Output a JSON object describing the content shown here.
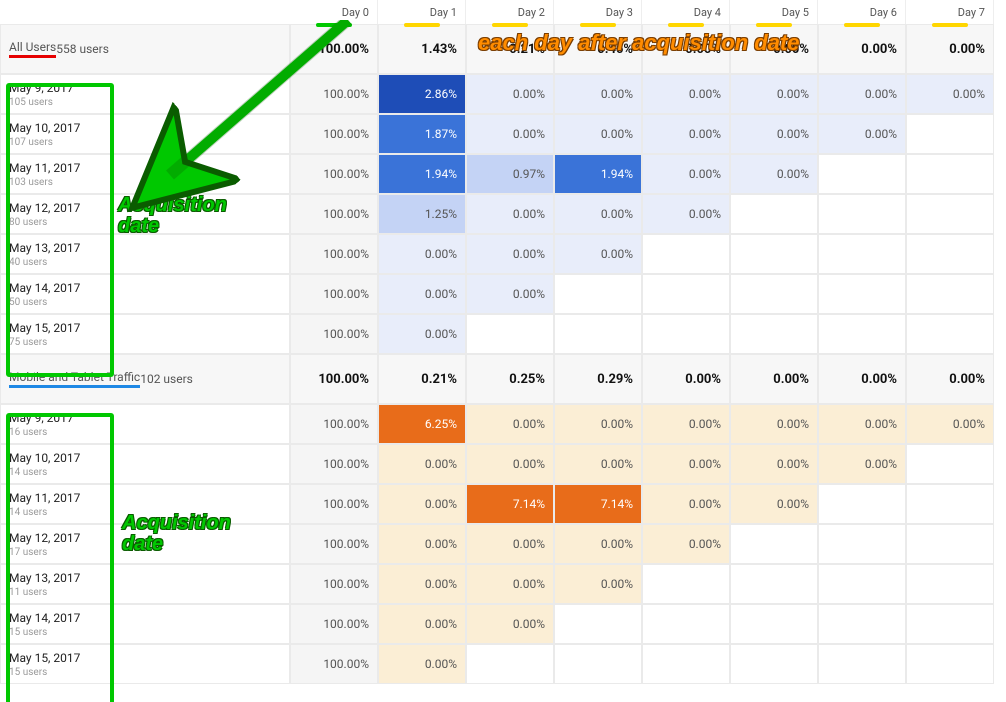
{
  "annotations": {
    "top": "each day after acquisition date",
    "acq1": "Acquisition\ndate",
    "acq2": "Acquisition\ndate"
  },
  "headers": [
    "Day 0",
    "Day 1",
    "Day 2",
    "Day 3",
    "Day 4",
    "Day 5",
    "Day 6",
    "Day 7"
  ],
  "header_underline_colors": [
    "#00c800",
    "#ffd600",
    "#ffd600",
    "#ffd600",
    "#ffd600",
    "#ffd600",
    "#ffd600",
    "#ffd600"
  ],
  "segments": [
    {
      "title": "All Users",
      "subtitle": "558 users",
      "underline": "red",
      "summary": [
        "100.00%",
        "1.43%",
        "0.21%",
        "0.46%",
        "0.00%",
        "0.00%",
        "0.00%",
        "0.00%"
      ],
      "palette": "blue",
      "rows": [
        {
          "date": "May 9, 2017",
          "users": "105 users",
          "cells": [
            {
              "v": "100.00%",
              "c": "day0"
            },
            {
              "v": "2.86%",
              "c": "b3"
            },
            {
              "v": "0.00%",
              "c": "b0"
            },
            {
              "v": "0.00%",
              "c": "b0"
            },
            {
              "v": "0.00%",
              "c": "b0"
            },
            {
              "v": "0.00%",
              "c": "b0"
            },
            {
              "v": "0.00%",
              "c": "b0"
            },
            {
              "v": "0.00%",
              "c": "b0"
            }
          ]
        },
        {
          "date": "May 10, 2017",
          "users": "107 users",
          "cells": [
            {
              "v": "100.00%",
              "c": "day0"
            },
            {
              "v": "1.87%",
              "c": "b2"
            },
            {
              "v": "0.00%",
              "c": "b0"
            },
            {
              "v": "0.00%",
              "c": "b0"
            },
            {
              "v": "0.00%",
              "c": "b0"
            },
            {
              "v": "0.00%",
              "c": "b0"
            },
            {
              "v": "0.00%",
              "c": "b0"
            },
            {
              "v": "",
              "c": "empty"
            }
          ]
        },
        {
          "date": "May 11, 2017",
          "users": "103 users",
          "cells": [
            {
              "v": "100.00%",
              "c": "day0"
            },
            {
              "v": "1.94%",
              "c": "b2"
            },
            {
              "v": "0.97%",
              "c": "b1"
            },
            {
              "v": "1.94%",
              "c": "b2"
            },
            {
              "v": "0.00%",
              "c": "b0"
            },
            {
              "v": "0.00%",
              "c": "b0"
            },
            {
              "v": "",
              "c": "empty"
            },
            {
              "v": "",
              "c": "empty"
            }
          ]
        },
        {
          "date": "May 12, 2017",
          "users": "80 users",
          "cells": [
            {
              "v": "100.00%",
              "c": "day0"
            },
            {
              "v": "1.25%",
              "c": "b1"
            },
            {
              "v": "0.00%",
              "c": "b0"
            },
            {
              "v": "0.00%",
              "c": "b0"
            },
            {
              "v": "0.00%",
              "c": "b0"
            },
            {
              "v": "",
              "c": "empty"
            },
            {
              "v": "",
              "c": "empty"
            },
            {
              "v": "",
              "c": "empty"
            }
          ]
        },
        {
          "date": "May 13, 2017",
          "users": "40 users",
          "cells": [
            {
              "v": "100.00%",
              "c": "day0"
            },
            {
              "v": "0.00%",
              "c": "b0"
            },
            {
              "v": "0.00%",
              "c": "b0"
            },
            {
              "v": "0.00%",
              "c": "b0"
            },
            {
              "v": "",
              "c": "empty"
            },
            {
              "v": "",
              "c": "empty"
            },
            {
              "v": "",
              "c": "empty"
            },
            {
              "v": "",
              "c": "empty"
            }
          ]
        },
        {
          "date": "May 14, 2017",
          "users": "50 users",
          "cells": [
            {
              "v": "100.00%",
              "c": "day0"
            },
            {
              "v": "0.00%",
              "c": "b0"
            },
            {
              "v": "0.00%",
              "c": "b0"
            },
            {
              "v": "",
              "c": "empty"
            },
            {
              "v": "",
              "c": "empty"
            },
            {
              "v": "",
              "c": "empty"
            },
            {
              "v": "",
              "c": "empty"
            },
            {
              "v": "",
              "c": "empty"
            }
          ]
        },
        {
          "date": "May 15, 2017",
          "users": "75 users",
          "cells": [
            {
              "v": "100.00%",
              "c": "day0"
            },
            {
              "v": "0.00%",
              "c": "b0"
            },
            {
              "v": "",
              "c": "empty"
            },
            {
              "v": "",
              "c": "empty"
            },
            {
              "v": "",
              "c": "empty"
            },
            {
              "v": "",
              "c": "empty"
            },
            {
              "v": "",
              "c": "empty"
            },
            {
              "v": "",
              "c": "empty"
            }
          ]
        }
      ]
    },
    {
      "title": "Mobile and Tablet Traffic",
      "subtitle": "102 users",
      "underline": "blue",
      "summary": [
        "100.00%",
        "0.21%",
        "0.25%",
        "0.29%",
        "0.00%",
        "0.00%",
        "0.00%",
        "0.00%"
      ],
      "palette": "orange",
      "rows": [
        {
          "date": "May 9, 2017",
          "users": "16 users",
          "cells": [
            {
              "v": "100.00%",
              "c": "day0"
            },
            {
              "v": "6.25%",
              "c": "o2"
            },
            {
              "v": "0.00%",
              "c": "o0"
            },
            {
              "v": "0.00%",
              "c": "o0"
            },
            {
              "v": "0.00%",
              "c": "o0"
            },
            {
              "v": "0.00%",
              "c": "o0"
            },
            {
              "v": "0.00%",
              "c": "o0"
            },
            {
              "v": "0.00%",
              "c": "o0"
            }
          ]
        },
        {
          "date": "May 10, 2017",
          "users": "14 users",
          "cells": [
            {
              "v": "100.00%",
              "c": "day0"
            },
            {
              "v": "0.00%",
              "c": "o0"
            },
            {
              "v": "0.00%",
              "c": "o0"
            },
            {
              "v": "0.00%",
              "c": "o0"
            },
            {
              "v": "0.00%",
              "c": "o0"
            },
            {
              "v": "0.00%",
              "c": "o0"
            },
            {
              "v": "0.00%",
              "c": "o0"
            },
            {
              "v": "",
              "c": "empty"
            }
          ]
        },
        {
          "date": "May 11, 2017",
          "users": "14 users",
          "cells": [
            {
              "v": "100.00%",
              "c": "day0"
            },
            {
              "v": "0.00%",
              "c": "o0"
            },
            {
              "v": "7.14%",
              "c": "o2"
            },
            {
              "v": "7.14%",
              "c": "o2"
            },
            {
              "v": "0.00%",
              "c": "o0"
            },
            {
              "v": "0.00%",
              "c": "o0"
            },
            {
              "v": "",
              "c": "empty"
            },
            {
              "v": "",
              "c": "empty"
            }
          ]
        },
        {
          "date": "May 12, 2017",
          "users": "17 users",
          "cells": [
            {
              "v": "100.00%",
              "c": "day0"
            },
            {
              "v": "0.00%",
              "c": "o0"
            },
            {
              "v": "0.00%",
              "c": "o0"
            },
            {
              "v": "0.00%",
              "c": "o0"
            },
            {
              "v": "0.00%",
              "c": "o0"
            },
            {
              "v": "",
              "c": "empty"
            },
            {
              "v": "",
              "c": "empty"
            },
            {
              "v": "",
              "c": "empty"
            }
          ]
        },
        {
          "date": "May 13, 2017",
          "users": "11 users",
          "cells": [
            {
              "v": "100.00%",
              "c": "day0"
            },
            {
              "v": "0.00%",
              "c": "o0"
            },
            {
              "v": "0.00%",
              "c": "o0"
            },
            {
              "v": "0.00%",
              "c": "o0"
            },
            {
              "v": "",
              "c": "empty"
            },
            {
              "v": "",
              "c": "empty"
            },
            {
              "v": "",
              "c": "empty"
            },
            {
              "v": "",
              "c": "empty"
            }
          ]
        },
        {
          "date": "May 14, 2017",
          "users": "15 users",
          "cells": [
            {
              "v": "100.00%",
              "c": "day0"
            },
            {
              "v": "0.00%",
              "c": "o0"
            },
            {
              "v": "0.00%",
              "c": "o0"
            },
            {
              "v": "",
              "c": "empty"
            },
            {
              "v": "",
              "c": "empty"
            },
            {
              "v": "",
              "c": "empty"
            },
            {
              "v": "",
              "c": "empty"
            },
            {
              "v": "",
              "c": "empty"
            }
          ]
        },
        {
          "date": "May 15, 2017",
          "users": "15 users",
          "cells": [
            {
              "v": "100.00%",
              "c": "day0"
            },
            {
              "v": "0.00%",
              "c": "o0"
            },
            {
              "v": "",
              "c": "empty"
            },
            {
              "v": "",
              "c": "empty"
            },
            {
              "v": "",
              "c": "empty"
            },
            {
              "v": "",
              "c": "empty"
            },
            {
              "v": "",
              "c": "empty"
            },
            {
              "v": "",
              "c": "empty"
            }
          ]
        }
      ]
    }
  ]
}
